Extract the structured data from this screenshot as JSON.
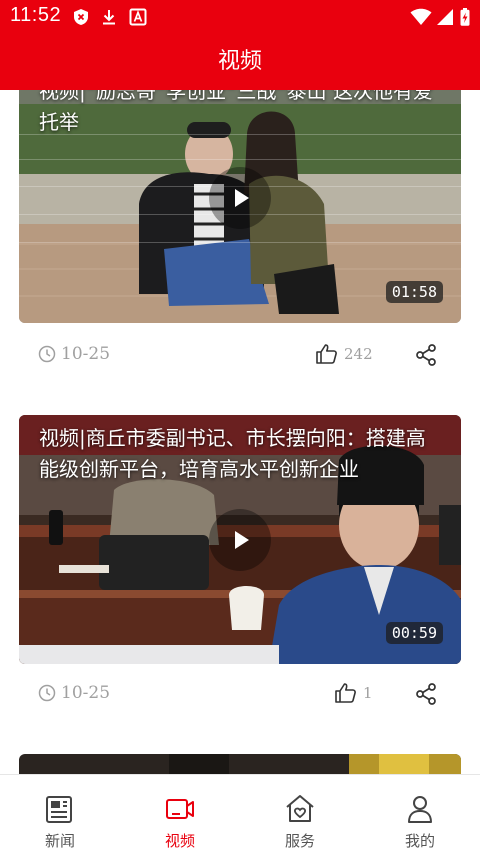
{
  "status_bar": {
    "time": "11:52",
    "icons": [
      "shield-x-icon",
      "download-icon",
      "font-a-icon",
      "wifi-icon",
      "signal-icon",
      "battery-charging-icon"
    ]
  },
  "header": {
    "title": "视频"
  },
  "videos": [
    {
      "title": "视频|“励志哥”李创业“三战”泰山 这次他有爱托举",
      "duration": "01:58",
      "date": "10-25",
      "likes": "242"
    },
    {
      "title": "视频|商丘市委副书记、市长摆向阳：搭建高能级创新平台，培育高水平创新企业",
      "duration": "00:59",
      "date": "10-25",
      "likes": "1"
    }
  ],
  "tabs": [
    {
      "label": "新闻",
      "icon": "newspaper-icon",
      "active": false
    },
    {
      "label": "视频",
      "icon": "video-icon",
      "active": true
    },
    {
      "label": "服务",
      "icon": "heart-home-icon",
      "active": false
    },
    {
      "label": "我的",
      "icon": "person-icon",
      "active": false
    }
  ],
  "colors": {
    "brand_red": "#e9000e",
    "meta_gray": "#a0a0a0"
  }
}
